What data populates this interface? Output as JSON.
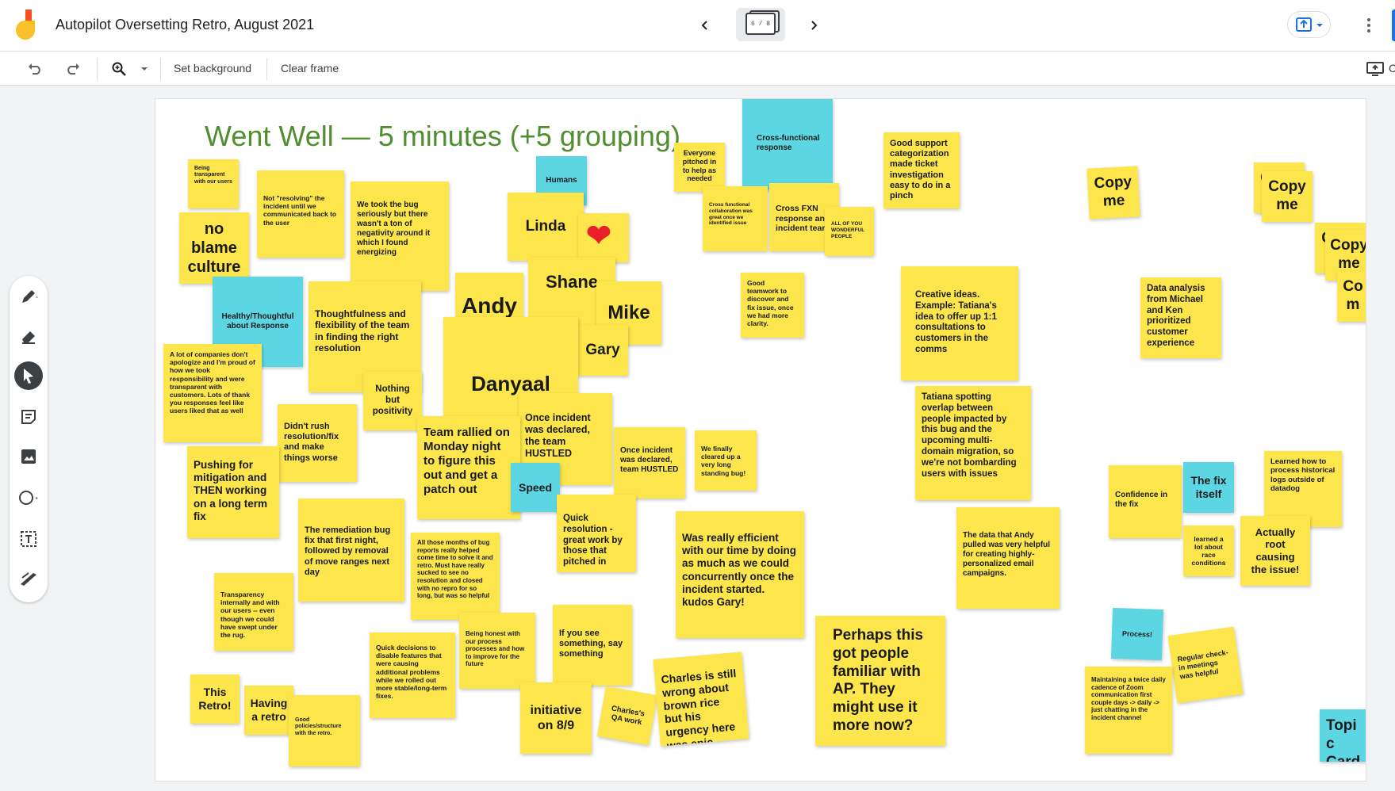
{
  "app": {
    "title": "Autopilot Oversetting Retro, August 2021",
    "frame_indicator": "6 / 8",
    "prev_icon": "chevron-left-icon",
    "next_icon": "chevron-right-icon"
  },
  "toolbar": {
    "set_background": "Set background",
    "clear_frame": "Clear frame",
    "edge_label": "C"
  },
  "tools": [
    "pen",
    "eraser",
    "select",
    "sticky-note",
    "image",
    "circle",
    "text-box",
    "laser"
  ],
  "frame": {
    "heading": "Went Well — 5 minutes (+5 grouping)"
  },
  "notes": {
    "n1": "Being transparent with our users",
    "n2": "no blame culture",
    "n3": "Not \"resolving\" the incident until we communicated back to the user",
    "n4": "We took the bug seriously but there wasn't a ton of negativity around it which I found energizing",
    "n5": "Humans",
    "n6": "Linda",
    "n7": "Healthy/Thoughtful about Response",
    "n8": "Thoughtfulness and flexibility of the team in finding the right resolution",
    "n9": "Andy",
    "n10": "Shane",
    "n11": "Mike",
    "n12": "Gary",
    "n13": "A lot of companies don't apologize and I'm proud of how we took responsibility and were transparent with customers. Lots of thank you responses feel like users liked that as well",
    "n14": "Danyaal",
    "n15": "Nothing but positivity",
    "n16": "Didn't rush resolution/fix and make things worse",
    "n17": "Once incident was declared, the team HUSTLED",
    "n18": "Team rallied on Monday night to figure this out and get a patch out",
    "n19": "Pushing for mitigation and THEN working on a long term fix",
    "n20": "Speed",
    "n21": "Once incident was declared, team HUSTLED",
    "n22": "We finally cleared up a very long standing bug!",
    "n23": "Quick resolution - great work by those that pitched in",
    "n24": "The remediation bug fix that first night, followed by removal of move ranges next day",
    "n25": "All those months of bug reports really helped come time to solve it and retro. Must have really sucked to see no resolution and closed with no repro for so long, but was so helpful",
    "n26": "Transparency internally and with our users -- even though we could have swept under the rug.",
    "n27": "Quick decisions to disable features that were causing additional problems while we rolled out more stable/long-term fixes.",
    "n28": "Being honest with our process processes and how to improve for the future",
    "n29": "If you see something, say something",
    "n30": "This Retro!",
    "n31": "Having a retro",
    "n32": "Good policies/structure with the retro.",
    "n33": "initiative on 8/9",
    "n34": "Charles's QA work",
    "n35": "Charles is still wrong about brown rice but his urgency here was epic",
    "n36": "Was really efficient with our time by doing as much as we could concurrently once the incident started. kudos Gary!",
    "n37": "Perhaps this got people familiar with AP. They might use it more now?",
    "n38": "Everyone pitched in to help as needed",
    "n39": "Cross-functional response",
    "n40": "Cross functional collaboration was great once we identified issue",
    "n41": "Cross FXN response and incident team",
    "n42": "ALL OF YOU WONDERFUL PEOPLE",
    "n43": "Good teamwork to discover and fix issue, once we had more clarity.",
    "n44": "Good support categorization made ticket investigation easy to do in a pinch",
    "n45": "Creative ideas. Example: Tatiana's idea to offer up 1:1 consultations to customers in the comms",
    "n46": "Tatiana spotting overlap between people impacted by this bug and the upcoming multi-domain migration, so we're not bombarding users with issues",
    "n47": "The data that Andy pulled was very helpful for creating highly-personalized email campaigns.",
    "n48": "Data analysis from Michael and Ken prioritized customer experience",
    "n49": "Copy me",
    "n50": "Copy me",
    "n51": "Copy me",
    "n52": "Copy me",
    "n53": "Copy me",
    "n54": "Co m",
    "n55": "Confidence in the fix",
    "n56": "The fix itself",
    "n57": "Learned how to process historical logs outside of datadog",
    "n58": "learned a lot about race conditions",
    "n59": "Actually root causing the issue!",
    "n60": "Process!",
    "n61": "Regular check-in meetings was helpful",
    "n62": "Maintaining a twice daily cadence of Zoom communication first couple days -> daily -> just chatting in the incident channel",
    "n63": "Topic Card"
  },
  "colors": {
    "note_yellow": "#fde64b",
    "note_cyan": "#5dd6e3",
    "heading_green": "#4f8f2f",
    "accent_blue": "#1a73e8"
  }
}
